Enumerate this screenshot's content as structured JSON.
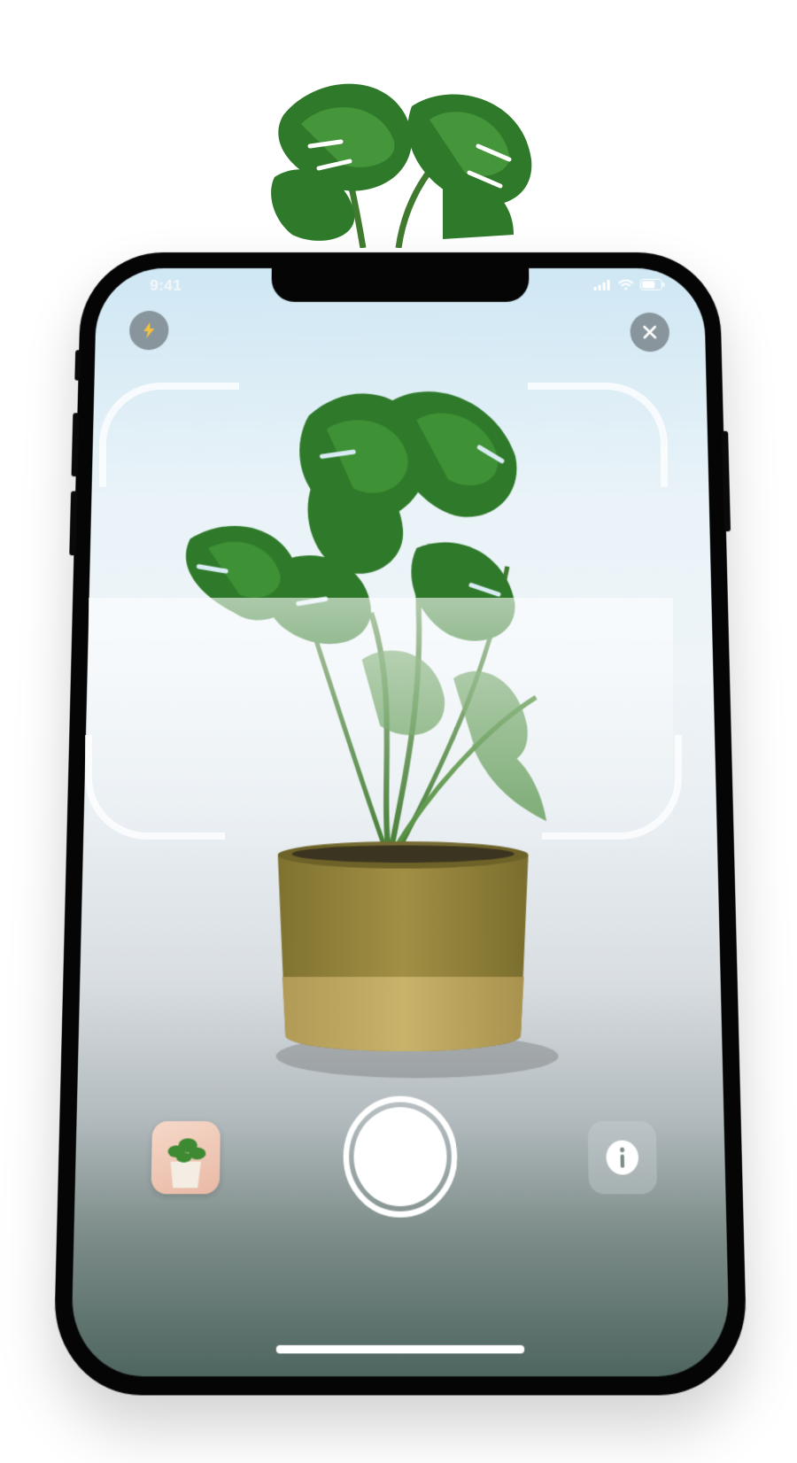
{
  "status_bar": {
    "time": "9:41"
  },
  "camera": {
    "flash_icon": "lightning-icon",
    "close_icon": "close-icon",
    "info_icon": "info-icon",
    "colors": {
      "flash_bolt": "#f5c242",
      "pot": "#9a8a3c",
      "leaf": "#2e7a2a"
    }
  }
}
